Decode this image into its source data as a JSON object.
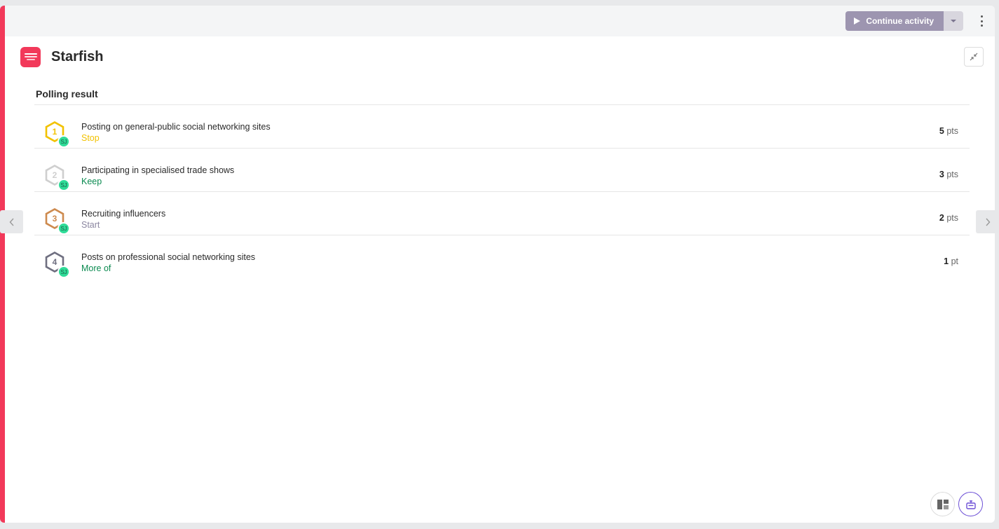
{
  "toolbar": {
    "continue_label": "Continue activity",
    "accent_color": "#9d95b0"
  },
  "header": {
    "title": "Starfish",
    "brand_color": "#f2395a",
    "logo_icon": "starfish-logo-icon",
    "collapse_icon": "collapse-arrows-icon"
  },
  "section": {
    "title": "Polling result"
  },
  "results": [
    {
      "rank": "1",
      "rank_color": "#f2c200",
      "title": "Posting on general-public social networking sites",
      "category": "Stop",
      "category_color": "#f2c200",
      "points": "5",
      "unit": "pts",
      "avatar": "SJ"
    },
    {
      "rank": "2",
      "rank_color": "#cfcfcf",
      "title": "Participating in specialised trade shows",
      "category": "Keep",
      "category_color": "#0b8a50",
      "points": "3",
      "unit": "pts",
      "avatar": "SJ"
    },
    {
      "rank": "3",
      "rank_color": "#cd8a4e",
      "title": "Recruiting influencers",
      "category": "Start",
      "category_color": "#8b86a0",
      "points": "2",
      "unit": "pts",
      "avatar": "SJ"
    },
    {
      "rank": "4",
      "rank_color": "#6f6f80",
      "title": "Posts on professional social networking sites",
      "category": "More of",
      "category_color": "#0b8a50",
      "points": "1",
      "unit": "pt",
      "avatar": "SJ"
    }
  ],
  "avatar_color": "#2fdc98"
}
